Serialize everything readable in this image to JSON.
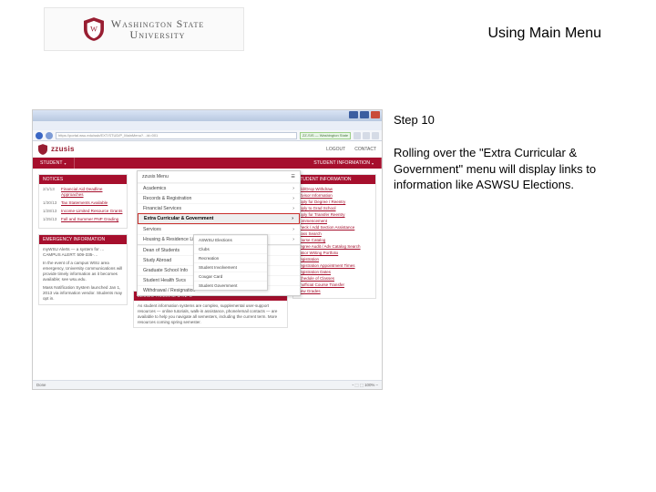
{
  "banner": {
    "university": "Washington State",
    "sub": "University"
  },
  "page_title": "Using Main Menu",
  "instructions": {
    "step_label": "Step 10",
    "body": "Rolling over the \"Extra Curricular & Government\" menu will display links to information like ASWSU Elections."
  },
  "browser": {
    "url": "https://portal.wsu.edu/ssb/EXT/STUD/P_MainMenu?…id=001",
    "ssl_label": "ZZ-SIS — Washington State",
    "window_buttons": [
      "min",
      "max",
      "close"
    ],
    "nav_arrows": [
      "back",
      "forward",
      "reload",
      "home"
    ]
  },
  "site": {
    "brand": "zzusis",
    "header_links": [
      "LOGOUT",
      "CONTACT"
    ],
    "nav_tabs": [
      "STUDENT"
    ],
    "right_tab_label": "STUDENT INFORMATION"
  },
  "menus": {
    "trigger": "zzusis Menu",
    "items": [
      "Academics",
      "Records & Registration",
      "Financial Services",
      "Extra Curricular & Government",
      "Services",
      "Housing & Residence Life"
    ],
    "active_index": 3,
    "submenu_for_active": [
      "ASWSU Elections",
      "Clubs",
      "Recreation",
      "Student Involvement",
      "Cougar Card",
      "Student Government"
    ],
    "secondary": [
      "Dean of Students",
      "Study Abroad",
      "Graduate School Info",
      "Student Health Svcs",
      "Withdrawal / Resignation"
    ]
  },
  "notices": {
    "title": "NOTICES",
    "rows": [
      {
        "date": "2/1/13",
        "title": "Financial Aid Deadline Approaches"
      },
      {
        "date": "1/30/13",
        "title": "Tax Statements Available"
      },
      {
        "date": "1/28/13",
        "title": "Income-Limited Resource Grants"
      },
      {
        "date": "1/25/13",
        "title": "Fall and Summer PNP Grading"
      }
    ]
  },
  "emergency": {
    "title": "EMERGENCY INFORMATION",
    "line1": "myWSU Alerts — a system for …",
    "line2": "CAMPUS ALERT: 509-335-…",
    "body": "In the event of a campus WSU area emergency, University communications will provide timely information as it becomes available; see wsu.edu.",
    "footer": "Mass Notification System launched Jan 1, 2013 via information vendor. Students may opt in."
  },
  "timeline": {
    "title": "ZZUSIS TIMELINE & INFO",
    "body": "As student information systems are complex, supplemental user-support resources — online tutorials, walk-in assistance, phone/email contacts — are available to help you navigate all semesters, including the current term. More resources coming spring semester."
  },
  "student_links_title": "STUDENT INFORMATION",
  "student_links": [
    "Add/Drop Withdraw",
    "Advisor Information",
    "Apply for Degree / Reentry",
    "Apply to Grad School",
    "Apply for Transfer Reentry",
    "Commencement",
    "Check / Add Section Assistance",
    "Class Search",
    "Course Catalog",
    "Degree Audit / Adv Catalog Search",
    "Junior Writing Portfolio",
    "Registration",
    "Registration Appointment Times",
    "Registration Dates",
    "Schedule of Classes",
    "Unofficial Course Transfer",
    "View Grades"
  ],
  "status_left": "Done",
  "status_right": "◔ ⬚ ⬚ 100% –"
}
